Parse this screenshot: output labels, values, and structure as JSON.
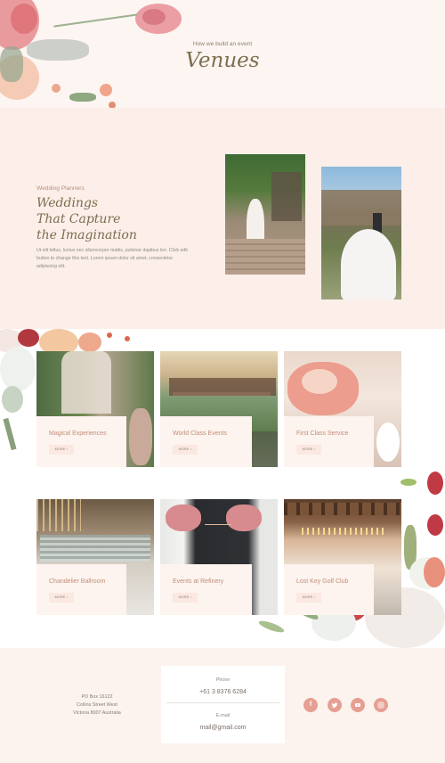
{
  "hero": {
    "subtitle": "How we build an event",
    "title": "Venues"
  },
  "planners": {
    "eyebrow": "Wedding Planners",
    "heading_lines": [
      "Weddings",
      "That Capture",
      "the Imagination"
    ],
    "body": "Ut elit tellus, luctus nec ullamcorper mattis, pulvinar dapibus leo. Click edit button to change this text. Lorem ipsum dolor sit amet, consectetur adipiscing elit."
  },
  "services": [
    {
      "title": "Magical Experiences",
      "more": "MORE  ›"
    },
    {
      "title": "World Class Events",
      "more": "MORE  ›"
    },
    {
      "title": "First Class Service",
      "more": "MORE  ›"
    },
    {
      "title": "Chandelier Ballroom",
      "more": "MORE  ›"
    },
    {
      "title": "Events at Refinery",
      "more": "MORE  ›"
    },
    {
      "title": "Lost Key Golf Club",
      "more": "MORE  ›"
    }
  ],
  "footer": {
    "address": [
      "PO Box 16122",
      "Collins Street West",
      "Victoria 8007 Australia"
    ],
    "phone_label": "Phone",
    "phone": "+61 3 8376 6284",
    "email_label": "E-mail",
    "email": "mail@gmail.com",
    "social_icons": [
      "facebook-icon",
      "twitter-icon",
      "youtube-icon",
      "instagram-icon"
    ]
  },
  "colors": {
    "accent": "#e69f92",
    "title_olive": "#7b6f4f",
    "card_title": "#c28c77"
  }
}
